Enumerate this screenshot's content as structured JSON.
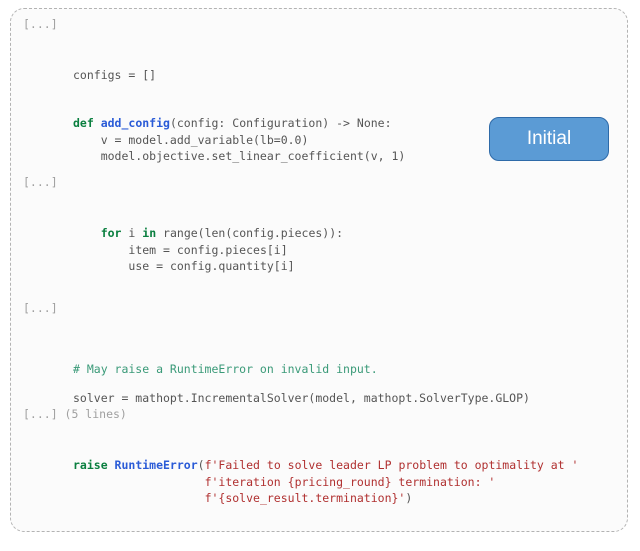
{
  "badge": {
    "label": "Initial"
  },
  "ellipses": {
    "top": "[...]",
    "mid1": "[...]",
    "mid2": "[...]",
    "bottom": "[...] (5 lines)"
  },
  "code": {
    "block1": {
      "l1a": "configs = []"
    },
    "block2": {
      "def": "def ",
      "fn": "add_config",
      "sig": "(config: Configuration) -> None:",
      "l2": "    v = model.add_variable(lb=0.0)",
      "l3": "    model.objective.set_linear_coefficient(v, 1)"
    },
    "block3": {
      "for": "for ",
      "var": "i",
      "in": " in ",
      "iter": "range(len(config.pieces)):",
      "l2": "    item = config.pieces[i]",
      "l3": "    use = config.quantity[i]"
    },
    "block4": {
      "comment": "# May raise a RuntimeError on invalid input.",
      "l2": "solver = mathopt.IncrementalSolver(model, mathopt.SolverType.GLOP)"
    },
    "block5": {
      "raise": "raise ",
      "err": "RuntimeError",
      "open": "(",
      "f1": "f'Failed to solve leader LP problem to optimality at '",
      "f2": "f'iteration {pricing_round} termination: '",
      "f3": "f'{solve_result.termination}'",
      "close": ")"
    }
  }
}
